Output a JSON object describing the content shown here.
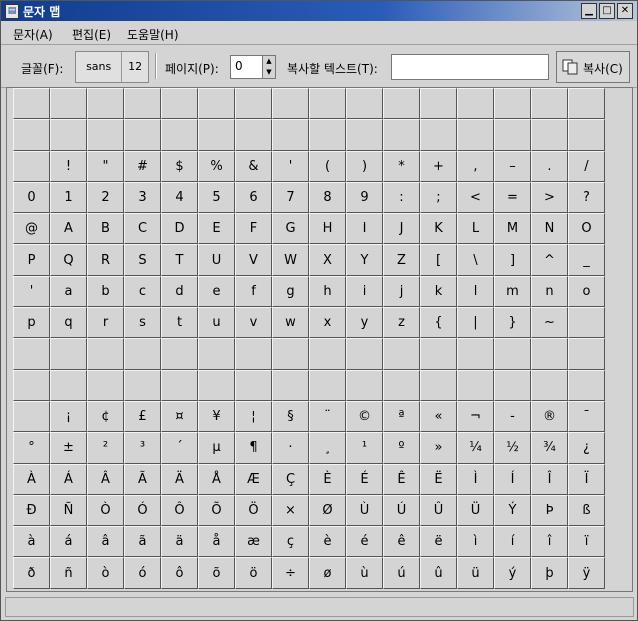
{
  "window": {
    "title": "문자 맵",
    "controls": [
      "minimize",
      "maximize",
      "close"
    ]
  },
  "menu": [
    {
      "label": "문자(A)"
    },
    {
      "label": "편집(E)"
    },
    {
      "label": "도움말(H)"
    }
  ],
  "toolbar": {
    "font_label": "글꼴(F):",
    "font_name": "sans",
    "font_size": "12",
    "page_label": "페이지(P):",
    "page_value": "0",
    "text_label": "복사할 텍스트(T):",
    "text_value": "",
    "copy_label": "복사(C)"
  },
  "grid": {
    "cells": [
      "",
      "",
      "",
      "",
      "",
      "",
      "",
      "",
      "",
      "",
      "",
      "",
      "",
      "",
      "",
      "",
      "",
      "",
      "",
      "",
      "",
      "",
      "",
      "",
      "",
      "",
      "",
      "",
      "",
      "",
      "",
      "",
      " ",
      "!",
      "\"",
      "#",
      "$",
      "%",
      "&",
      "'",
      "(",
      ")",
      "*",
      "+",
      ",",
      "–",
      ".",
      "/",
      "0",
      "1",
      "2",
      "3",
      "4",
      "5",
      "6",
      "7",
      "8",
      "9",
      ":",
      ";",
      "<",
      "=",
      ">",
      "?",
      "@",
      "A",
      "B",
      "C",
      "D",
      "E",
      "F",
      "G",
      "H",
      "I",
      "J",
      "K",
      "L",
      "M",
      "N",
      "O",
      "P",
      "Q",
      "R",
      "S",
      "T",
      "U",
      "V",
      "W",
      "X",
      "Y",
      "Z",
      "[",
      "\\",
      "]",
      "^",
      "_",
      "'",
      "a",
      "b",
      "c",
      "d",
      "e",
      "f",
      "g",
      "h",
      "i",
      "j",
      "k",
      "l",
      "m",
      "n",
      "o",
      "p",
      "q",
      "r",
      "s",
      "t",
      "u",
      "v",
      "w",
      "x",
      "y",
      "z",
      "{",
      "|",
      "}",
      "~",
      "",
      "",
      "",
      "",
      "",
      "",
      "",
      "",
      "",
      "",
      "",
      "",
      "",
      "",
      "",
      "",
      "",
      "",
      "",
      "",
      "",
      "",
      "",
      "",
      "",
      "",
      "",
      "",
      "",
      "",
      "",
      "",
      "",
      "",
      "¡",
      "¢",
      "£",
      "¤",
      "¥",
      "¦",
      "§",
      "¨",
      "©",
      "ª",
      "«",
      "¬",
      "-",
      "®",
      "¯",
      "°",
      "±",
      "²",
      "³",
      "´",
      "µ",
      "¶",
      "·",
      "¸",
      "¹",
      "º",
      "»",
      "¼",
      "½",
      "¾",
      "¿",
      "À",
      "Á",
      "Â",
      "Ã",
      "Ä",
      "Å",
      "Æ",
      "Ç",
      "È",
      "É",
      "Ê",
      "Ë",
      "Ì",
      "Í",
      "Î",
      "Ï",
      "Đ",
      "Ñ",
      "Ò",
      "Ó",
      "Ô",
      "Õ",
      "Ö",
      "×",
      "Ø",
      "Ù",
      "Ú",
      "Û",
      "Ü",
      "Ý",
      "Þ",
      "ß",
      "à",
      "á",
      "â",
      "ã",
      "ä",
      "å",
      "æ",
      "ç",
      "è",
      "é",
      "ê",
      "ë",
      "ì",
      "í",
      "î",
      "ï",
      "ð",
      "ñ",
      "ò",
      "ó",
      "ô",
      "õ",
      "ö",
      "÷",
      "ø",
      "ù",
      "ú",
      "û",
      "ü",
      "ý",
      "þ",
      "ÿ"
    ]
  },
  "statusbar": {
    "text": ""
  }
}
